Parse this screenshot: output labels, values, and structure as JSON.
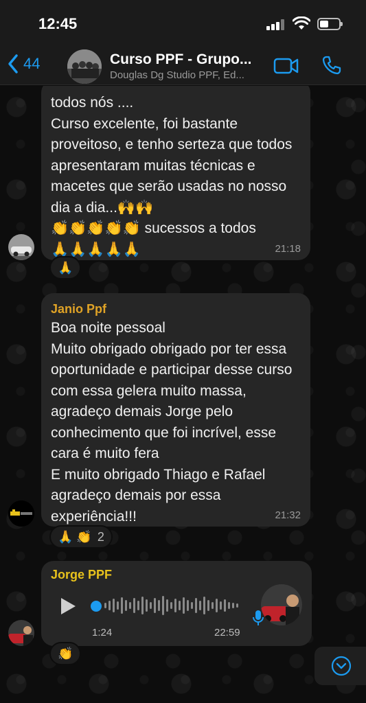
{
  "status": {
    "time": "12:45"
  },
  "header": {
    "back_count": "44",
    "title": "Curso PPF - Grupo...",
    "subtitle": "Douglas Dg Studio PPF, Ed..."
  },
  "messages": [
    {
      "text": "todos nós ....\nCurso excelente,  foi bastante proveitoso,  e tenho serteza que todos apresentaram muitas técnicas e macetes que serão usadas no nosso dia a dia...🙌🙌\n👏👏👏👏👏 sucessos a todos\n🙏🙏🙏🙏🙏",
      "time": "21:18",
      "reactions": "🙏"
    },
    {
      "sender": "Janio Ppf",
      "sender_color": "#e0a326",
      "text": "Boa noite pessoal\nMuito obrigado obrigado por ter essa oportunidade e participar desse curso com essa gelera muito massa, agradeço demais Jorge pelo conhecimento que foi incrível, esse cara é muito fera\nE muito obrigado Thiago e Rafael agradeço demais por essa experiência!!!",
      "time": "21:32",
      "reactions": "🙏 👏",
      "reaction_count": "2"
    },
    {
      "sender": "Jorge PPF",
      "sender_color": "#e8c21c",
      "voice_duration": "1:24",
      "time": "22:59",
      "reactions": "👏"
    }
  ],
  "icons": {
    "back": "chevron-left-icon",
    "video": "video-camera-icon",
    "call": "phone-icon",
    "play": "play-icon",
    "mic": "microphone-icon",
    "scroll": "chevron-down-circle-icon"
  },
  "colors": {
    "accent": "#1c9bf0",
    "bubble": "#262626",
    "background": "#0d0d0d"
  }
}
